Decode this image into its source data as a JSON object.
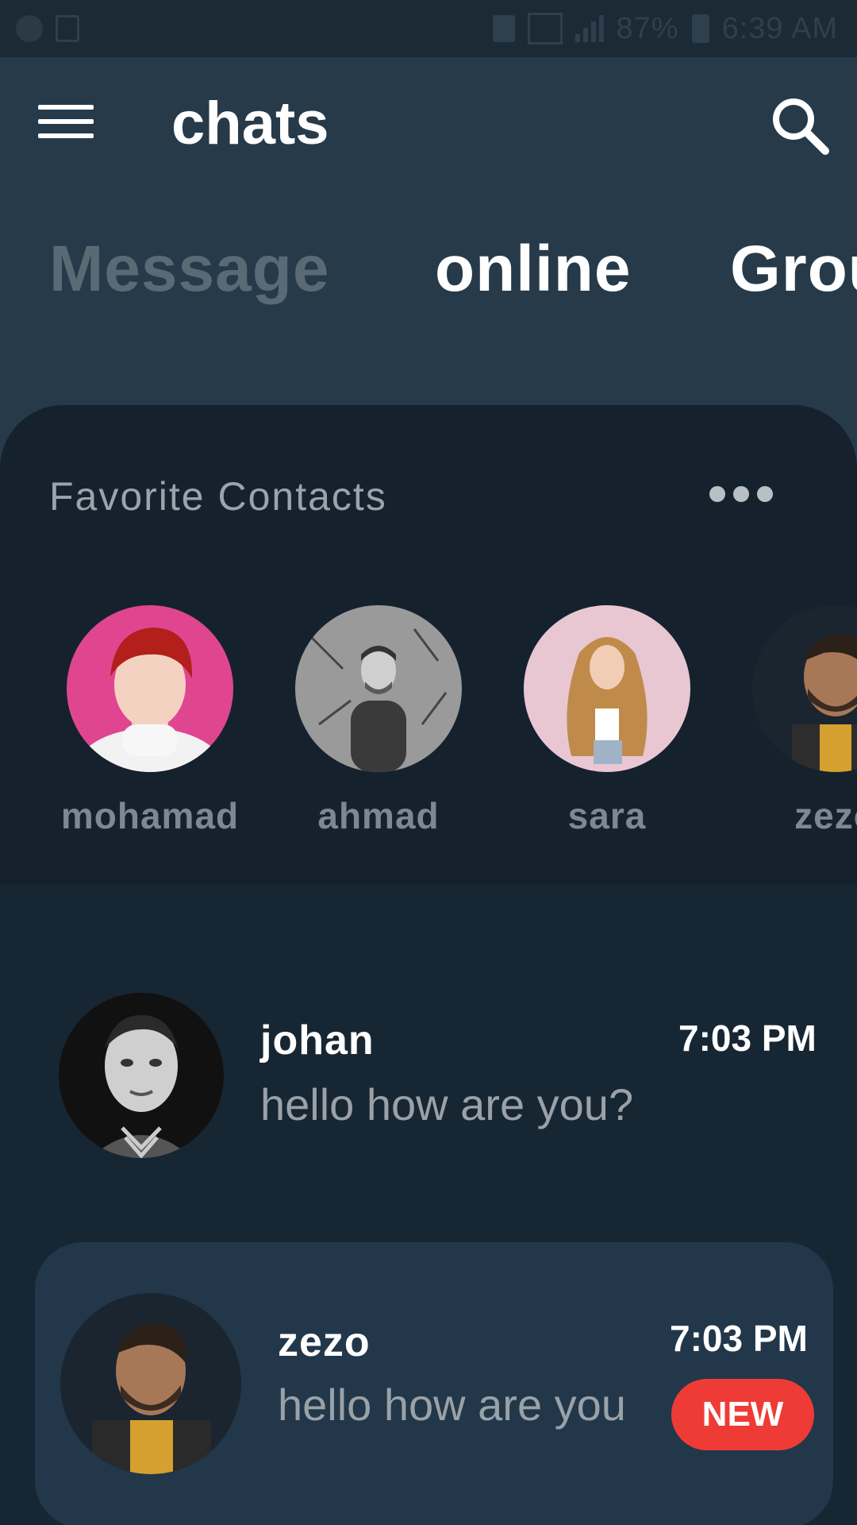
{
  "status_bar": {
    "battery": "87%",
    "time": "6:39 AM"
  },
  "header": {
    "title": "chats",
    "menu_icon": "menu-icon",
    "search_icon": "search-icon"
  },
  "tabs": [
    {
      "label": "Message"
    },
    {
      "label": "online"
    },
    {
      "label": "Groups"
    }
  ],
  "favorites": {
    "title": "Favorite Contacts",
    "more_icon": "more-horizontal-icon",
    "contacts": [
      {
        "name": "mohamad"
      },
      {
        "name": "ahmad"
      },
      {
        "name": "sara"
      },
      {
        "name": "zezo"
      }
    ]
  },
  "chats": [
    {
      "name": "johan",
      "message": "hello how are you?",
      "time": "7:03 PM",
      "unread": false
    },
    {
      "name": "zezo",
      "message": "hello how are you",
      "time": "7:03 PM",
      "unread": true,
      "badge": "NEW"
    }
  ],
  "colors": {
    "background": "#263a4a",
    "panel": "#172633",
    "favorites_bg": "#15222e",
    "highlight_row": "#22374a",
    "badge": "#ef3b35",
    "muted_text": "#9aa1a7"
  }
}
